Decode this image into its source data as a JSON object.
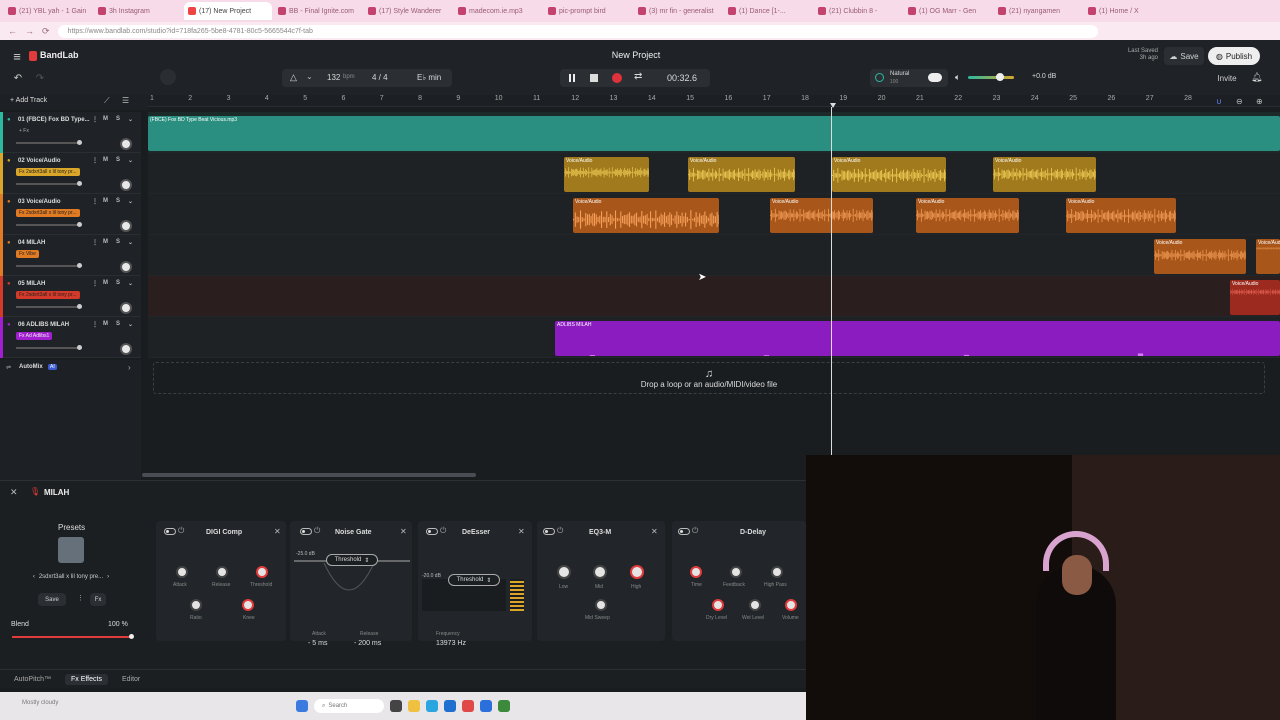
{
  "browser": {
    "tabs": [
      "(21) YBL yah - 1 Gain",
      "3h Instagram",
      "(17) New Project",
      "BB - Final Ignite.com",
      "(17) Style Wanderer",
      "madecom.ie.mp3",
      "pic-prompt bird",
      "(3) mr fin - generalist",
      "(1) Dance [1-...",
      "(21) Clubbin 8 -",
      "(1) OG Marr - Gen",
      "(21) nyangamen",
      "(1) Home / X"
    ],
    "url": "https://www.bandlab.com/studio?id=718fa265-5be8-4781-80c5-5665544c7f-tab"
  },
  "app": {
    "brand": "BandLab",
    "project_title": "New Project",
    "last_saved": "Last Saved",
    "last_saved_ago": "3h ago",
    "save_label": "Save",
    "publish_label": "Publish",
    "invite_label": "Invite"
  },
  "transport": {
    "bpm": "132",
    "bpm_unit": "bpm",
    "time_sig": "4 / 4",
    "key": "E♭ min",
    "time": "00:32.6",
    "reverb_label": "Natural",
    "reverb_value": "100",
    "master_db": "+0.0 dB"
  },
  "ruler": [
    "1",
    "2",
    "3",
    "4",
    "5",
    "6",
    "7",
    "8",
    "9",
    "10",
    "11",
    "12",
    "13",
    "14",
    "15",
    "16",
    "17",
    "18",
    "19",
    "20",
    "21",
    "22",
    "23",
    "24",
    "25",
    "26",
    "27",
    "28"
  ],
  "add_track_label": "Add Track",
  "tracks": [
    {
      "name": "01 (FBCE) Fox BD Type...",
      "fx": "+ Fx",
      "fx_color": "#1f2327",
      "text_color": "#aaa",
      "accent": "#2bb9a0"
    },
    {
      "name": "02 Voice/Audio",
      "fx": "Fx 2sdxrt3all x lil tony pr...",
      "fx_color": "#d9a62a",
      "text_color": "#222",
      "accent": "#d9a62a"
    },
    {
      "name": "03 Voice/Audio",
      "fx": "Fx 2sdxrt3all x lil tony pr...",
      "fx_color": "#e07a23",
      "text_color": "#222",
      "accent": "#e07a23"
    },
    {
      "name": "04 MILAH",
      "fx": "Fx Vibe",
      "fx_color": "#e07a23",
      "text_color": "#222",
      "accent": "#e07a23"
    },
    {
      "name": "05 MILAH",
      "fx": "Fx 2sdxrt3all x lil tony pr...",
      "fx_color": "#d33a2a",
      "text_color": "#222",
      "accent": "#d33a2a"
    },
    {
      "name": "06 ADLIBS MILAH",
      "fx": "Fx Ad Adlibs1",
      "fx_color": "#a21fd0",
      "text_color": "#eee",
      "accent": "#a21fd0"
    }
  ],
  "automix_label": "AutoMix",
  "automix_badge": "AI",
  "clips": {
    "track1_label": "(FBCE) Fox BD Type Beat Vicious.mp3",
    "voice_label": "Voice/Audio",
    "adlibs_label": "ADLIBS MILAH"
  },
  "drop_zone": "Drop a loop or an audio/MIDI/video file",
  "panel": {
    "track_name": "MILAH",
    "presets_label": "Presets",
    "preset_name": "2sdxrt3all x lil tony pre...",
    "save_label": "Save",
    "blend_label": "Blend",
    "blend_value": "100 %",
    "modules": [
      {
        "title": "DIGI Comp",
        "knobs": [
          "Attack",
          "Release",
          "Threshold",
          "Ratio",
          "Knee"
        ]
      },
      {
        "title": "Noise Gate",
        "threshold_label": "Threshold",
        "db_tag": "-25.0 dB",
        "attack_label": "Attack",
        "attack_value": "5 ms",
        "release_label": "Release",
        "release_value": "200 ms"
      },
      {
        "title": "DeEsser",
        "threshold_label": "Threshold",
        "db_tag": "-20.0 dB",
        "freq_label": "Frequency",
        "freq_value": "13973 Hz"
      },
      {
        "title": "EQ3-M",
        "knobs": [
          "Low",
          "Mid",
          "High",
          "Mid Sweep"
        ]
      },
      {
        "title": "D-Delay",
        "knobs": [
          "Time",
          "Feedback",
          "High Pass",
          "Dry Level",
          "Wet Level",
          "Volume"
        ]
      }
    ],
    "bottom_tabs": [
      "AutoPitch™",
      "Fx Effects",
      "Editor"
    ]
  },
  "taskbar": {
    "search_placeholder": "Search",
    "tray_text": "Mostly cloudy"
  },
  "colors": {
    "track1": "#2bb9a0",
    "voice2": "#d9a62a",
    "voice3": "#e07a23",
    "milah5": "#c73a28",
    "adlibs": "#a21fd0",
    "record": "#e0323a"
  }
}
